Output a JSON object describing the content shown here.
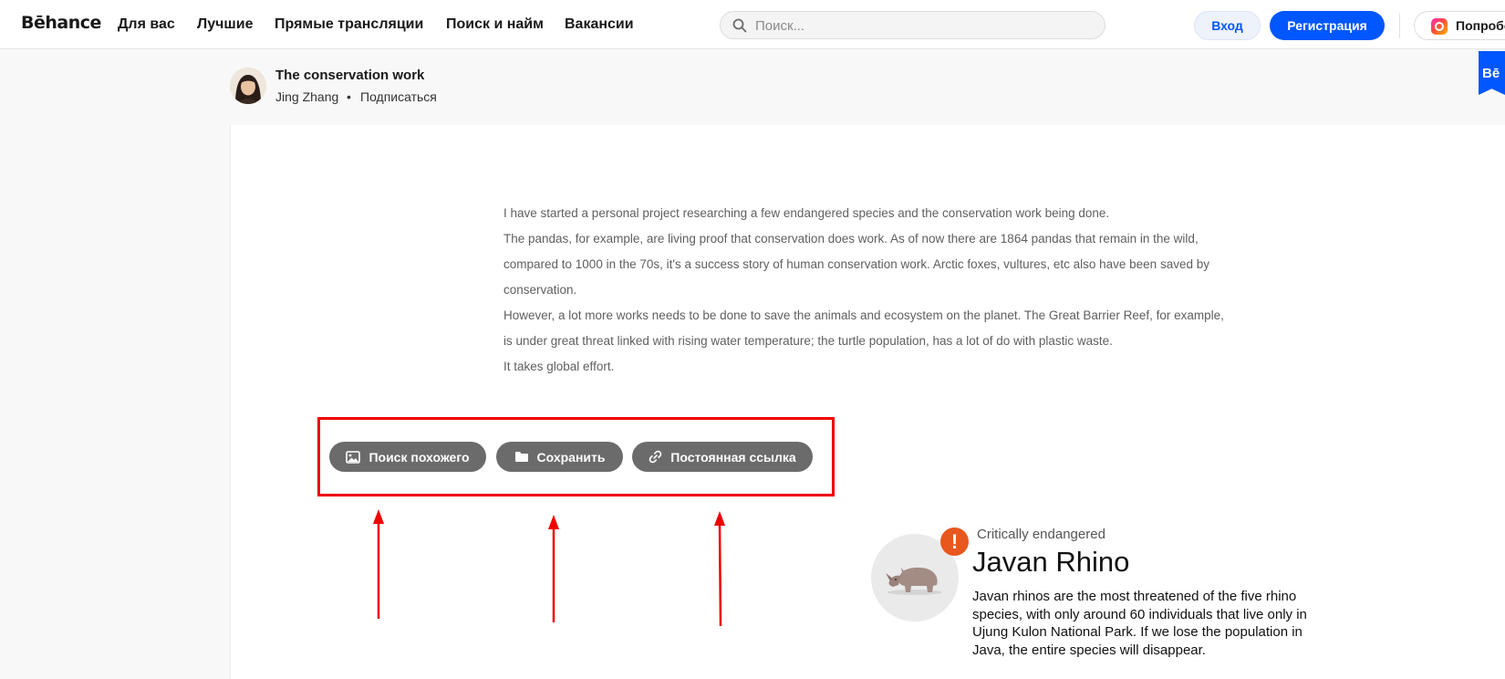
{
  "nav": {
    "logo": "Bēhance",
    "links": [
      "Для вас",
      "Лучшие",
      "Прямые трансляции",
      "Поиск и найм",
      "Вакансии"
    ],
    "search_placeholder": "Поиск...",
    "login": "Вход",
    "register": "Регистрация",
    "try": "Попробовать"
  },
  "project": {
    "title": "The conservation work",
    "author": "Jing Zhang",
    "separator": "•",
    "follow": "Подписаться",
    "badge": "Bē"
  },
  "description": [
    "I have started a personal project researching a few endangered species and the conservation work being done.",
    "The pandas, for example, are living proof that conservation does work. As of now there are 1864 pandas that remain in the wild, compared to 1000 in the 70s, it's a success story of human conservation work. Arctic foxes, vultures, etc also have been saved by conservation.",
    "However, a lot more works needs to be done to save the animals and ecosystem on the planet. The Great Barrier Reef, for example, is under great threat linked with rising water temperature; the turtle population, has a lot of do with plastic waste.",
    "It takes global effort."
  ],
  "actions": {
    "find_similar": "Поиск похожего",
    "save": "Сохранить",
    "permalink": "Постоянная ссылка"
  },
  "species": {
    "status": "Critically endangered",
    "alert_glyph": "!",
    "name": "Javan Rhino",
    "description": "Javan rhinos are the most threatened of the five rhino species, with only around 60 individuals that live only in Ujung Kulon National Park. If we lose the population in Java, the entire species will disappear."
  },
  "colors": {
    "brand_blue": "#0057ff",
    "action_gray": "#6b6b6b",
    "annotation_red": "#ee0000",
    "alert_orange": "#e8571e"
  }
}
